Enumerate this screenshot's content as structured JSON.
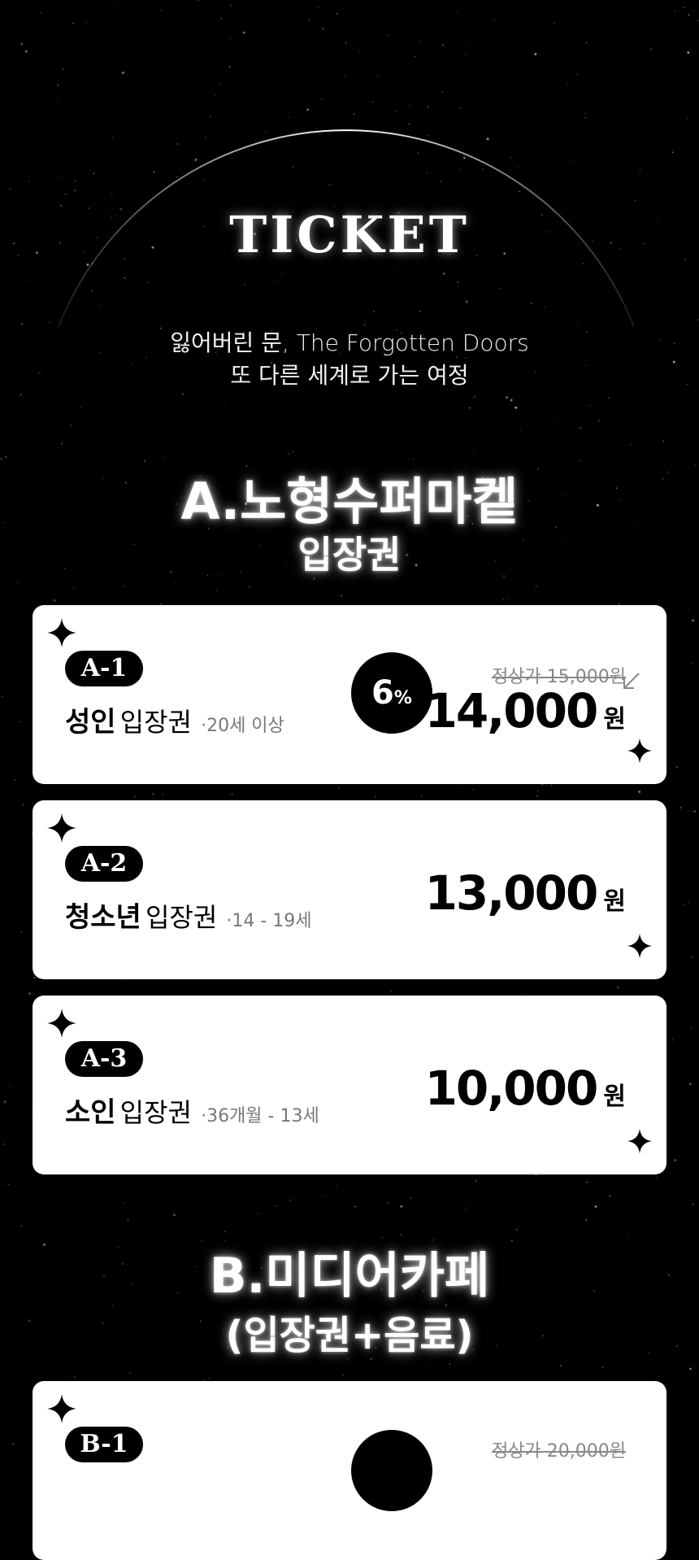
{
  "hero": {
    "title": "TICKET",
    "subtitle_line1": "잃어버린 문, The Forgotten Doors",
    "subtitle_line2": "또 다른 세계로 가는 여정"
  },
  "section_a": {
    "title_line1": "A.노형수퍼마켙",
    "title_line2": "입장권",
    "tickets": [
      {
        "code": "A-1",
        "type": "성인",
        "suffix": "입장권",
        "age": "·20세 이상",
        "discount_num": "6",
        "discount_sym": "%",
        "original_price": "정상가 15,000원",
        "price": "14,000",
        "unit": "원"
      },
      {
        "code": "A-2",
        "type": "청소년",
        "suffix": "입장권",
        "age": "·14 - 19세",
        "price": "13,000",
        "unit": "원"
      },
      {
        "code": "A-3",
        "type": "소인",
        "suffix": "입장권",
        "age": "·36개월 - 13세",
        "price": "10,000",
        "unit": "원"
      }
    ]
  },
  "section_b": {
    "title_line1": "B.미디어카페",
    "title_line2": "(입장권+음료)",
    "tickets": [
      {
        "code": "B-1",
        "original_price": "정상가 20,000원"
      }
    ]
  },
  "colors": {
    "background": "#000000",
    "card": "#ffffff",
    "text_dark": "#000000",
    "muted": "#777777"
  },
  "icons": [
    "sparkle-icon",
    "arrow-down-left-icon"
  ]
}
